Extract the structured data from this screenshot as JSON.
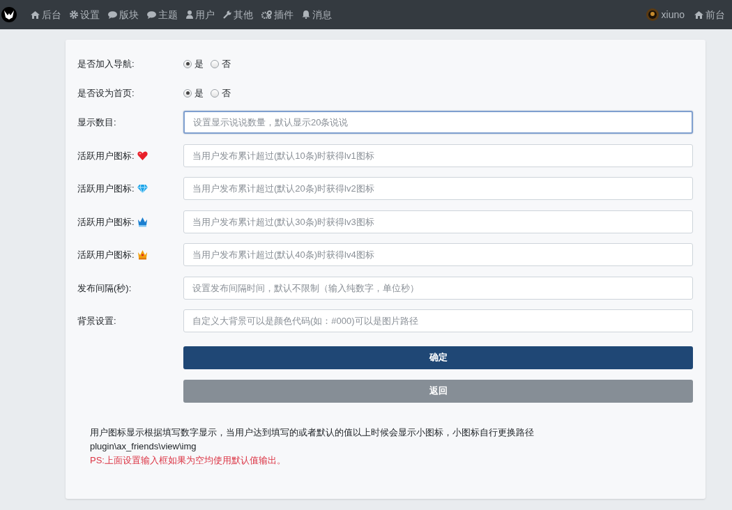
{
  "nav": {
    "items": [
      {
        "kind": "home",
        "label": "后台"
      },
      {
        "kind": "gear",
        "label": "设置"
      },
      {
        "kind": "chat",
        "label": "版块"
      },
      {
        "kind": "chat",
        "label": "主题"
      },
      {
        "kind": "user",
        "label": "用户"
      },
      {
        "kind": "wrench",
        "label": "其他"
      },
      {
        "kind": "gears",
        "label": "插件"
      },
      {
        "kind": "bell",
        "label": "消息"
      }
    ],
    "user": "xiuno",
    "front": {
      "kind": "home",
      "label": "前台"
    }
  },
  "form": {
    "rows": [
      {
        "kind": "radio",
        "label": "是否加入导航:",
        "options": [
          {
            "label": "是",
            "selected": true
          },
          {
            "label": "否",
            "selected": false
          }
        ]
      },
      {
        "kind": "radio",
        "label": "是否设为首页:",
        "options": [
          {
            "label": "是",
            "selected": true
          },
          {
            "label": "否",
            "selected": false
          }
        ]
      },
      {
        "kind": "input",
        "label": "显示数目:",
        "placeholder": "设置显示说说数量，默认显示20条说说",
        "focused": true
      },
      {
        "kind": "input",
        "label": "活跃用户图标:",
        "badge": {
          "kind": "heart"
        },
        "placeholder": "当用户发布累计超过(默认10条)时获得lv1图标",
        "focused": false
      },
      {
        "kind": "input",
        "label": "活跃用户图标:",
        "badge": {
          "kind": "diamond"
        },
        "placeholder": "当用户发布累计超过(默认20条)时获得lv2图标",
        "focused": false
      },
      {
        "kind": "input",
        "label": "活跃用户图标:",
        "badge": {
          "kind": "bluecrown"
        },
        "placeholder": "当用户发布累计超过(默认30条)时获得lv3图标",
        "focused": false
      },
      {
        "kind": "input",
        "label": "活跃用户图标:",
        "badge": {
          "kind": "goldcrown"
        },
        "placeholder": "当用户发布累计超过(默认40条)时获得lv4图标",
        "focused": false
      },
      {
        "kind": "input",
        "label": "发布间隔(秒):",
        "placeholder": "设置发布间隔时间，默认不限制（输入纯数字，单位秒）",
        "focused": false
      },
      {
        "kind": "input",
        "label": "背景设置:",
        "placeholder": "自定义大背景可以是颜色代码(如：#000)可以是图片路径",
        "focused": false
      }
    ],
    "buttons": [
      {
        "kind": "primary",
        "label": "确定"
      },
      {
        "kind": "secondary",
        "label": "返回"
      }
    ]
  },
  "notes": [
    {
      "kind": "plain",
      "text": "用户图标显示根据填写数字显示，当用户达到填写的或者默认的值以上时候会显示小图标，小图标自行更换路径"
    },
    {
      "kind": "plain",
      "text": "plugin\\ax_friends\\view\\img"
    },
    {
      "kind": "warning",
      "text": "PS:上面设置输入框如果为空均使用默认值输出。"
    }
  ]
}
